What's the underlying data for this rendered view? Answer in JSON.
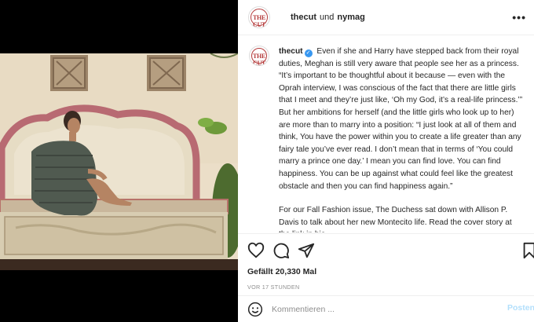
{
  "post": {
    "header": {
      "account_primary": "thecut",
      "joiner": "und",
      "account_secondary": "nymag",
      "avatar_text": "THE CUT",
      "more_icon": "more-horizontal-icon"
    },
    "caption": {
      "username": "thecut",
      "verified_icon": "verified-badge-icon",
      "paragraph_1": "Even if she and Harry have stepped back from their royal duties, Meghan is still very aware that people see her as a princess. “It’s important to be thoughtful about it because — even with the Oprah interview, I was conscious of the fact that there are little girls that I meet and they’re just like, ‘Oh my God, it’s a real-life princess.’” But her ambitions for herself (and the little girls who look up to her) are more than to marry into a position: “I just look at all of them and think, You have the power within you to create a life greater than any fairy tale you’ve ever read. I don’t mean that in terms of ‘You could marry a prince one day.’ I mean you can find love. You can find happiness. You can be up against what could feel like the greatest obstacle and then you can find happiness again.”",
      "paragraph_2": "For our Fall Fashion issue, The Duchess sat down with Allison P. Davis to talk about her new Montecito life. Read the cover story at the link in bio."
    },
    "actions": {
      "like_icon": "heart-icon",
      "comment_icon": "comment-icon",
      "share_icon": "paper-plane-icon",
      "save_icon": "bookmark-icon"
    },
    "likes_text": "Gefällt 20,330 Mal",
    "timestamp": "VOR 17 STUNDEN",
    "comment": {
      "emoji_icon": "smiley-icon",
      "placeholder": "Kommentieren ...",
      "value": "",
      "post_label": "Posten"
    },
    "colors": {
      "accent_blue": "#3897f0",
      "post_disabled": "#b2dffc",
      "brand_red": "#b43a3a"
    }
  }
}
